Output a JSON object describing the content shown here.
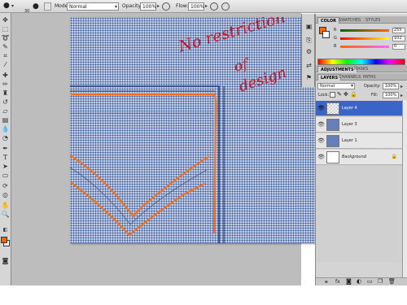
{
  "options_bar": {
    "brush_size": "30",
    "mode_label": "Mode:",
    "mode_value": "Normal",
    "opacity_label": "Opacity:",
    "opacity_value": "100%",
    "flow_label": "Flow:",
    "flow_value": "100%"
  },
  "canvas": {
    "scribble_line1": "No restriction",
    "scribble_line2": "of",
    "scribble_line3": "design",
    "stroke_color": "#f07020",
    "text_color": "#c0182a"
  },
  "color_panel": {
    "tabs": [
      "COLOR",
      "SWATCHES",
      "STYLES"
    ],
    "channels": [
      {
        "label": "R",
        "value": "255"
      },
      {
        "label": "G",
        "value": "102"
      },
      {
        "label": "B",
        "value": "0"
      }
    ],
    "foreground_color": "#ff6600"
  },
  "adjustments_panel": {
    "tabs": [
      "ADJUSTMENTS",
      "MASKS"
    ]
  },
  "layers_panel": {
    "tabs": [
      "LAYERS",
      "CHANNELS",
      "PATHS"
    ],
    "blend_mode": "Normal",
    "opacity_label": "Opacity:",
    "opacity_value": "100%",
    "lock_label": "Lock:",
    "fill_label": "Fill:",
    "fill_value": "100%",
    "layers": [
      {
        "name": "Layer 4",
        "active": true
      },
      {
        "name": "Layer 3",
        "active": false
      },
      {
        "name": "Layer 1",
        "active": false
      },
      {
        "name": "Background",
        "active": false
      }
    ]
  },
  "toolbox": {
    "foreground_color": "#f06a00",
    "background_color": "#ffffff"
  }
}
